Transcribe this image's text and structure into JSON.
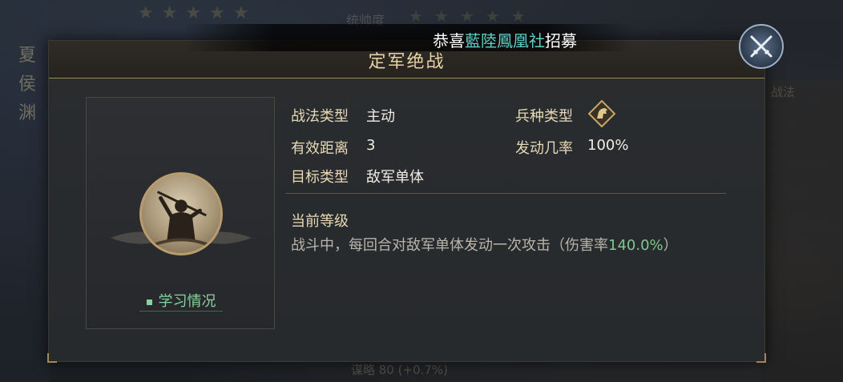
{
  "background": {
    "vertical_name": [
      "夏",
      "侯",
      "渊"
    ],
    "stars_left": "★★★★★",
    "stars_right": "★★★★★",
    "top_label": "统帅度",
    "bottom_text": "谋略 80  (+0.7%)",
    "right_text": "战法"
  },
  "ticker": {
    "prefix": "恭喜",
    "highlight": "藍陸鳳凰社",
    "suffix": "招募"
  },
  "panel": {
    "title": "定军绝战"
  },
  "skill": {
    "learn_label": "学习情况"
  },
  "info": {
    "type_label": "战法类型",
    "type_value": "主动",
    "troop_label": "兵种类型",
    "troop_icon": "cavalry-horse-icon",
    "range_label": "有效距离",
    "range_value": "3",
    "rate_label": "发动几率",
    "rate_value": "100%",
    "target_label": "目标类型",
    "target_value": "敌军单体"
  },
  "level": {
    "label": "当前等级",
    "desc_prefix": "战斗中，每回合对敌军单体发动一次攻击（伤害率",
    "desc_percent": "140.0%",
    "desc_suffix": "）"
  },
  "colors": {
    "accent_gold": "#a0875a",
    "highlight_green": "#7fc88f",
    "ticker_cyan": "#5fd0c7"
  }
}
